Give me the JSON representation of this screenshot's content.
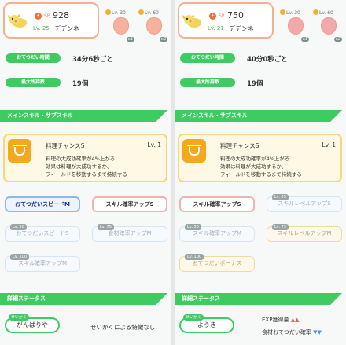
{
  "left": {
    "profile": {
      "sp_label": "SP",
      "sp": "928",
      "level": "Lv. 25",
      "name": "デデンネ"
    },
    "ingredients": [
      {
        "lv": "Lv. 30",
        "count": "x1",
        "style": "peach"
      },
      {
        "lv": "Lv. 60",
        "count": "x2",
        "style": "peach"
      }
    ],
    "help_time_label": "おてつだい時間",
    "help_time": "34分6秒ごと",
    "max_carry_label": "最大所持数",
    "max_carry": "19個",
    "skill_banner": "メインスキル・サブスキル",
    "skill": {
      "name": "料理チャンスS",
      "lv": "Lv. 1",
      "lines": [
        "料理の大成功確率が4%上がる",
        "効果は料理が大成功するか、",
        "フィールドを移動するまで持続する"
      ]
    },
    "subskills": [
      {
        "label": "おてつだいスピードM",
        "tag": ""
      },
      {
        "label": "スキル確率アップS",
        "tag": ""
      },
      {
        "label": "おてつだいスピードS",
        "tag": "Lv. 50"
      },
      {
        "label": "食材確率アップM",
        "tag": "Lv. 75"
      },
      {
        "label": "スキル確率アップM",
        "tag": "Lv. 100"
      }
    ],
    "status_banner": "詳細ステータス",
    "nature_tag": "せいかく",
    "nature": "がんばりや",
    "nature_effect": "せいかくによる特徴なし"
  },
  "right": {
    "profile": {
      "sp_label": "SP",
      "sp": "750",
      "level": "Lv. 21",
      "name": "デデンネ"
    },
    "ingredients": [
      {
        "lv": "Lv. 30",
        "count": "x1",
        "style": "pink"
      },
      {
        "lv": "Lv. 60",
        "count": "x2",
        "style": "pink"
      }
    ],
    "help_time_label": "おてつだい時間",
    "help_time": "40分0秒ごと",
    "max_carry_label": "最大所持数",
    "max_carry": "19個",
    "skill_banner": "メインスキル・サブスキル",
    "skill": {
      "name": "料理チャンスS",
      "lv": "Lv. 1",
      "lines": [
        "料理の大成功確率が4%上がる",
        "効果は料理が大成功するか、",
        "フィールドを移動するまで持続する"
      ]
    },
    "subskills": [
      {
        "label": "スキル確率アップS",
        "tag": ""
      },
      {
        "label": "スキルレベルアップS",
        "tag": "Lv. 25"
      },
      {
        "label": "スキル確率アップM",
        "tag": "Lv. 50"
      },
      {
        "label": "スキルレベルアップM",
        "tag": "Lv. 75"
      },
      {
        "label": "おてつだいボーナス",
        "tag": "Lv. 100"
      }
    ],
    "status_banner": "詳細ステータス",
    "nature_tag": "せいかく",
    "nature": "ようき",
    "effect_up": "EXP獲得量",
    "effect_up_arrows": "▲▲",
    "effect_down": "食材おてつだい確率",
    "effect_down_arrows": "▼▼"
  },
  "colors": {
    "accent": "#3ecb62",
    "card_border": "#f3b28f",
    "skill_border": "#f7d779",
    "main_skill": "#8db9ea"
  }
}
